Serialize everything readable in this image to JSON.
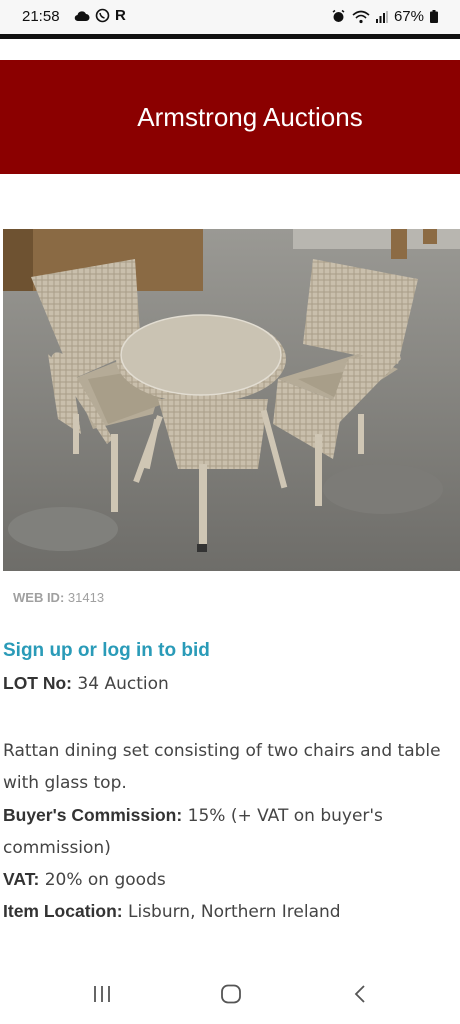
{
  "status_bar": {
    "time": "21:58",
    "left_icons": [
      "cloud-icon",
      "viber-icon",
      "r-icon"
    ],
    "r_label": "R",
    "battery": "67%"
  },
  "header": {
    "title": "Armstrong Auctions",
    "bg_color": "#8b0000"
  },
  "lot": {
    "web_id_label": "WEB ID:",
    "web_id_value": "31413",
    "bid_link": "Sign up or log in to bid",
    "lot_no_label": "LOT No:",
    "lot_no_value": "34 Auction",
    "description": "Rattan dining set consisting of two chairs and table with glass top.",
    "commission_label": "Buyer's Commission:",
    "commission_value": "15% (+ VAT on buyer's commission)",
    "vat_label": "VAT:",
    "vat_value": "20% on goods",
    "location_label": "Item Location:",
    "location_value": "Lisburn, Northern Ireland"
  },
  "nav": {
    "icons": [
      "recent-apps-icon",
      "home-icon",
      "back-icon"
    ]
  },
  "colors": {
    "link": "#2a9bb8",
    "header": "#8b0000"
  }
}
